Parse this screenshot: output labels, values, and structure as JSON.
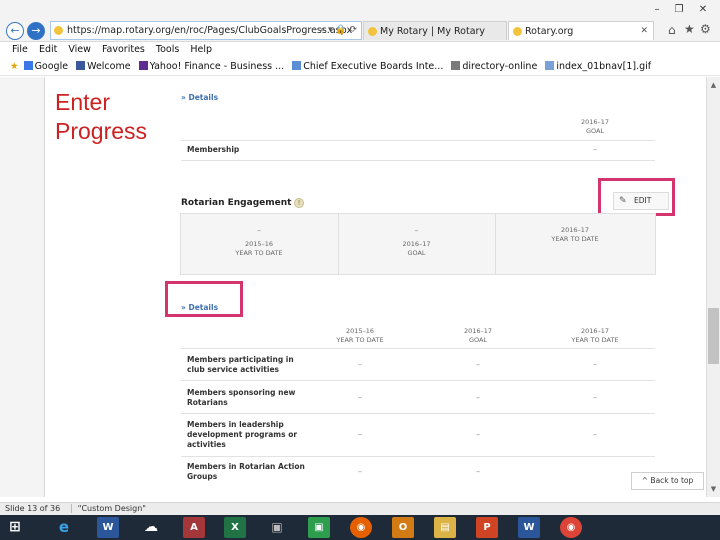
{
  "browser": {
    "address": "https://map.rotary.org/en/roc/Pages/ClubGoalsProgress.aspx",
    "tabs": [
      {
        "label": "My Rotary | My Rotary"
      },
      {
        "label": "Rotary.org"
      }
    ],
    "menu": [
      "File",
      "Edit",
      "View",
      "Favorites",
      "Tools",
      "Help"
    ],
    "favorites": [
      "Google",
      "Welcome",
      "Yahoo! Finance - Business ...",
      "Chief Executive Boards Inte...",
      "directory-online",
      "index_01bnav[1].gif"
    ],
    "colors": {
      "accent": "#2f72c5",
      "highlight": "#d5356f",
      "title": "#cc2222"
    }
  },
  "slide": {
    "title": "Enter Progress"
  },
  "page": {
    "details_top": "Details",
    "goal_col": {
      "year": "2016–17",
      "label": "GOAL"
    },
    "membership": {
      "label": "Membership",
      "value": "–"
    },
    "engagement": {
      "title": "Rotarian Engagement",
      "edit_label": "EDIT",
      "cards": [
        {
          "value": "–",
          "year": "2015–16",
          "label": "YEAR TO DATE"
        },
        {
          "value": "–",
          "year": "2016–17",
          "label": "GOAL"
        },
        {
          "value": "",
          "year": "2016–17",
          "label": "YEAR TO DATE"
        }
      ]
    },
    "details_lower": "Details",
    "table": {
      "headers": [
        {
          "year": "2015–16",
          "label": "YEAR TO DATE"
        },
        {
          "year": "2016–17",
          "label": "GOAL"
        },
        {
          "year": "2016–17",
          "label": "YEAR TO DATE"
        }
      ],
      "rows": [
        {
          "line1": "Members participating in",
          "line2": "club service activities",
          "line3": "",
          "values": [
            "–",
            "–",
            "–"
          ]
        },
        {
          "line1": "Members sponsoring new",
          "line2": "Rotarians",
          "line3": "",
          "values": [
            "–",
            "–",
            "–"
          ]
        },
        {
          "line1": "Members in leadership",
          "line2": "development programs or",
          "line3": "activities",
          "values": [
            "–",
            "–",
            "–"
          ]
        },
        {
          "line1": "Members in Rotarian Action",
          "line2": "Groups",
          "line3": "",
          "values": [
            "–",
            "–",
            "–"
          ]
        }
      ]
    },
    "back_to_top": "^ Back to top"
  },
  "status": {
    "slide": "Slide 13 of 36",
    "design": "\"Custom Design\""
  }
}
